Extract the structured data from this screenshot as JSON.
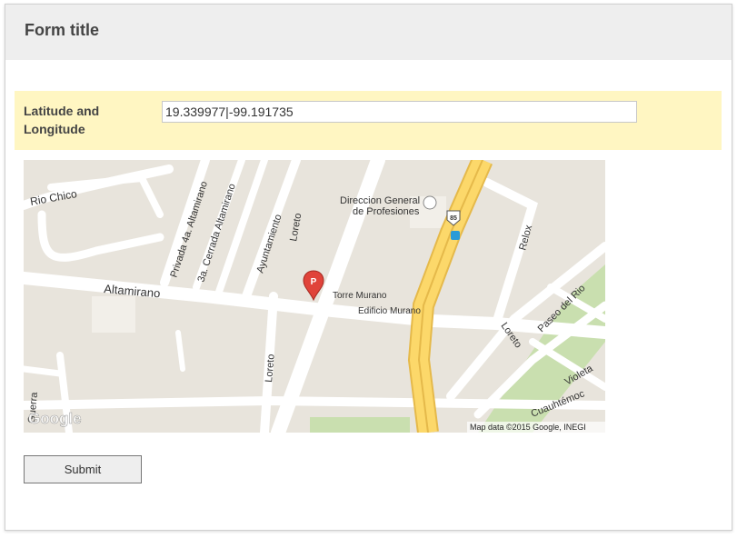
{
  "form": {
    "title": "Form title",
    "submit_label": "Submit"
  },
  "location_field": {
    "label": "Latitude and Longitude",
    "value": "19.339977|-99.191735"
  },
  "map": {
    "marker_letter": "P",
    "attribution": "Map data ©2015 Google, INEGI",
    "logo_text": "Google",
    "highway_shield": "85",
    "labels": {
      "rio_chico": "Rio Chico",
      "altamirano": "Altamirano",
      "privada_altamirano": "Privada 4a. Altamirano",
      "cerrada_altamirano": "3a. Cerrada Altamirano",
      "ayuntamiento": "Ayuntamiento",
      "loreto_top": "Loreto",
      "loreto_bottom": "Loreto",
      "loreto_right": "Loreto",
      "direccion_1": "Direccion General",
      "direccion_2": "de Profesiones",
      "relox": "Relox",
      "torre_murano": "Torre Murano",
      "edificio_murano": "Edificio Murano",
      "paseo_del_rio": "Paseo del Rio",
      "violeta": "Violeta",
      "cuauhtemoc": "Cuauhtémoc",
      "guerra": "Guerra"
    },
    "colors": {
      "land": "#e8e4dc",
      "road": "#ffffff",
      "highway": "#fcd86a",
      "highway_edge": "#e5b94a",
      "park": "#c9dfaf",
      "marker": "#e0433a"
    }
  }
}
